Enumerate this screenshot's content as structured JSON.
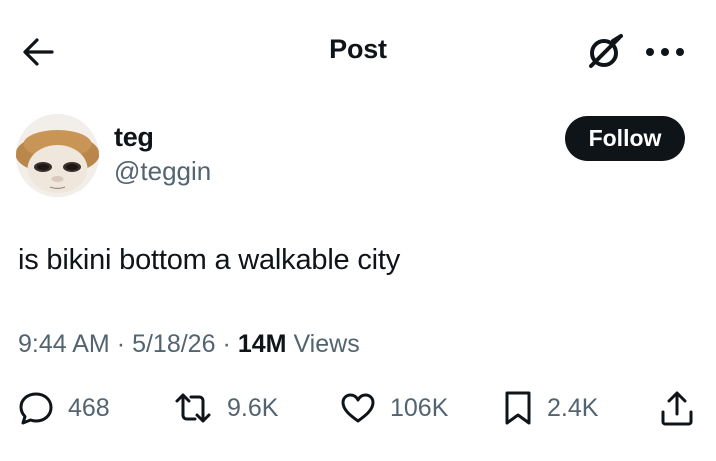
{
  "header": {
    "title": "Post"
  },
  "author": {
    "name": "teg",
    "handle": "@teggin"
  },
  "follow_button": {
    "label": "Follow"
  },
  "post": {
    "text": "is bikini bottom a walkable city",
    "time": "9:44 AM",
    "date": "5/18/26",
    "separator": "·",
    "views_count": "14M",
    "views_label": "Views"
  },
  "actions": {
    "replies": "468",
    "reposts": "9.6K",
    "likes": "106K",
    "bookmarks": "2.4K"
  },
  "icons": {
    "back": "arrow-left-icon",
    "grok": "grok-icon",
    "more": "more-horizontal-icon",
    "reply": "speech-bubble-icon",
    "repost": "repost-arrows-icon",
    "like": "heart-icon",
    "bookmark": "bookmark-icon",
    "share": "share-upload-icon"
  },
  "colors": {
    "text_primary": "#0f1419",
    "text_secondary": "#536471",
    "follow_bg": "#0f1419",
    "background": "#ffffff"
  }
}
